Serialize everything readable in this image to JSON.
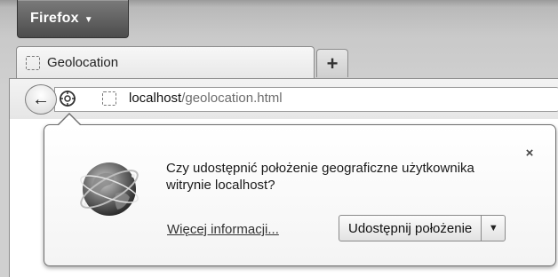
{
  "app_button": {
    "label": "Firefox",
    "icon": "caret-down-icon"
  },
  "tabs": [
    {
      "title": "Geolocation",
      "icon": "page-placeholder-icon"
    }
  ],
  "new_tab": {
    "label": "+"
  },
  "navbar": {
    "back_icon": "back-arrow-icon",
    "identity_icon": "site-identity-icon",
    "url_host": "localhost",
    "url_path": "/geolocation.html"
  },
  "notification": {
    "icon": "globe-icon",
    "message": "Czy udostępnić położenie geograficzne użytkownika witrynie localhost?",
    "learn_more": "Więcej informacji...",
    "share_button": "Udostępnij położenie",
    "dropdown_icon": "dropdown-arrow-icon",
    "close_label": "×"
  }
}
